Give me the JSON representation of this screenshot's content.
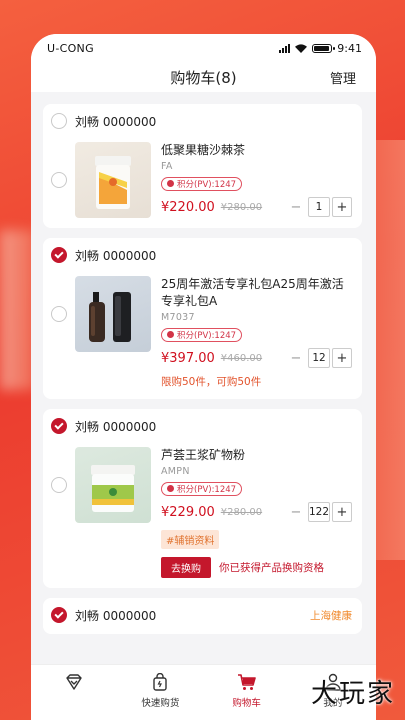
{
  "status_bar": {
    "carrier": "U-CONG",
    "time": "9:41"
  },
  "header": {
    "title": "购物车(8)",
    "manage": "管理"
  },
  "cart": [
    {
      "shop": "刘畅 0000000",
      "checked": false,
      "item": {
        "checked": false,
        "name": "低聚果糖沙棘茶",
        "sku": "FA",
        "pv": "积分(PV):1247",
        "price": "¥220.00",
        "old_price": "¥280.00",
        "qty": "1"
      }
    },
    {
      "shop": "刘畅 0000000",
      "checked": true,
      "item": {
        "checked": false,
        "name": "25周年激活专享礼包A25周年激活专享礼包A",
        "sku": "M7037",
        "pv": "积分(PV):1247",
        "price": "¥397.00",
        "old_price": "¥460.00",
        "qty": "12",
        "limit": "限购50件，可购50件"
      }
    },
    {
      "shop": "刘畅 0000000",
      "checked": true,
      "item": {
        "checked": false,
        "name": "芦荟王浆矿物粉",
        "sku": "AMPN",
        "pv": "积分(PV):1247",
        "price": "¥229.00",
        "old_price": "¥280.00",
        "qty": "122",
        "tag": "#辅销资料",
        "swap_button": "去换购",
        "swap_text": "你已获得产品换购资格"
      }
    },
    {
      "shop": "刘畅 0000000",
      "checked": true,
      "shop_tag": "上海健康"
    }
  ],
  "tabbar": [
    {
      "label": "",
      "icon": "diamond-icon"
    },
    {
      "label": "快速购货",
      "icon": "bag-icon"
    },
    {
      "label": "购物车",
      "icon": "cart-icon",
      "active": true
    },
    {
      "label": "我的",
      "icon": "person-icon"
    }
  ],
  "watermark": "大玩家",
  "colors": {
    "accent": "#c4172c",
    "background": "#ec3d2f"
  }
}
